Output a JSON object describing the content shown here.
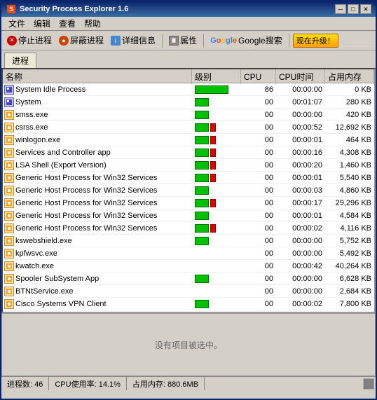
{
  "titleBar": {
    "title": "Security Process Explorer 1.6",
    "minBtn": "─",
    "maxBtn": "□",
    "closeBtn": "✕"
  },
  "menuBar": {
    "items": [
      "文件",
      "编辑",
      "查看",
      "帮助"
    ]
  },
  "toolbar": {
    "stopProcess": "停止进程",
    "hideProcess": "屏蔽进程",
    "details": "详细信息",
    "properties": "属性",
    "googleSearch": "Google搜索",
    "upgrade": "现在升级！"
  },
  "processTab": {
    "label": "进程"
  },
  "tableHeaders": {
    "name": "名称",
    "level": "级别",
    "cpu": "CPU",
    "cpuTime": "CPU时间",
    "memUsage": "占用内存"
  },
  "processes": [
    {
      "name": "System Idle Process",
      "hasIcon": true,
      "iconType": "sys",
      "level": "big-green",
      "cpu": "86",
      "cpuTime": "00:00:00",
      "mem": "0 KB"
    },
    {
      "name": "System",
      "hasIcon": true,
      "iconType": "sys",
      "level": "small-green",
      "cpu": "00",
      "cpuTime": "00:01:07",
      "mem": "280 KB"
    },
    {
      "name": "smss.exe",
      "hasIcon": true,
      "iconType": "exe",
      "level": "small-green",
      "cpu": "00",
      "cpuTime": "00:00:00",
      "mem": "420 KB"
    },
    {
      "name": "csrss.exe",
      "hasIcon": true,
      "iconType": "exe",
      "level": "green-red",
      "cpu": "00",
      "cpuTime": "00:00:52",
      "mem": "12,692 KB"
    },
    {
      "name": "winlogon.exe",
      "hasIcon": true,
      "iconType": "exe",
      "level": "green-red",
      "cpu": "00",
      "cpuTime": "00:00:01",
      "mem": "464 KB"
    },
    {
      "name": "Services and Controller app",
      "hasIcon": true,
      "iconType": "exe",
      "level": "green-red",
      "cpu": "00",
      "cpuTime": "00:00:16",
      "mem": "4,308 KB"
    },
    {
      "name": "LSA Shell (Export Version)",
      "hasIcon": true,
      "iconType": "exe",
      "level": "green-red",
      "cpu": "00",
      "cpuTime": "00:00:20",
      "mem": "1,460 KB"
    },
    {
      "name": "Generic Host Process for Win32 Services",
      "hasIcon": true,
      "iconType": "exe",
      "level": "green-red",
      "cpu": "00",
      "cpuTime": "00:00:01",
      "mem": "5,540 KB"
    },
    {
      "name": "Generic Host Process for Win32 Services",
      "hasIcon": true,
      "iconType": "exe",
      "level": "small-green",
      "cpu": "00",
      "cpuTime": "00:00:03",
      "mem": "4,860 KB"
    },
    {
      "name": "Generic Host Process for Win32 Services",
      "hasIcon": true,
      "iconType": "exe",
      "level": "green-red",
      "cpu": "00",
      "cpuTime": "00:00:17",
      "mem": "29,296 KB"
    },
    {
      "name": "Generic Host Process for Win32 Services",
      "hasIcon": true,
      "iconType": "exe",
      "level": "small-green",
      "cpu": "00",
      "cpuTime": "00:00:01",
      "mem": "4,584 KB"
    },
    {
      "name": "Generic Host Process for Win32 Services",
      "hasIcon": true,
      "iconType": "exe",
      "level": "green-red",
      "cpu": "00",
      "cpuTime": "00:00:02",
      "mem": "4,116 KB"
    },
    {
      "name": "kswebshield.exe",
      "hasIcon": true,
      "iconType": "exe",
      "level": "small-green",
      "cpu": "00",
      "cpuTime": "00:00:00",
      "mem": "5,752 KB"
    },
    {
      "name": "kpfwsvc.exe",
      "hasIcon": true,
      "iconType": "exe",
      "level": "none",
      "cpu": "00",
      "cpuTime": "00:00:00",
      "mem": "5,492 KB"
    },
    {
      "name": "kwatch.exe",
      "hasIcon": true,
      "iconType": "exe",
      "level": "none",
      "cpu": "00",
      "cpuTime": "00:00:42",
      "mem": "40,264 KB"
    },
    {
      "name": "Spooler SubSystem App",
      "hasIcon": true,
      "iconType": "exe",
      "level": "small-green",
      "cpu": "00",
      "cpuTime": "00:00:00",
      "mem": "6,628 KB"
    },
    {
      "name": "BTNtService.exe",
      "hasIcon": true,
      "iconType": "exe",
      "level": "none",
      "cpu": "00",
      "cpuTime": "00:00:00",
      "mem": "2,684 KB"
    },
    {
      "name": "Cisco Systems VPN Client",
      "hasIcon": true,
      "iconType": "exe",
      "level": "small-green",
      "cpu": "00",
      "cpuTime": "00:00:02",
      "mem": "7,800 KB"
    }
  ],
  "bottomPanel": {
    "noSelection": "没有项目被选中。"
  },
  "statusBar": {
    "processCount": "进程数: 46",
    "cpuUsage": "CPU使用率: 14.1%",
    "memUsage": "占用内存: 880.6MB"
  }
}
